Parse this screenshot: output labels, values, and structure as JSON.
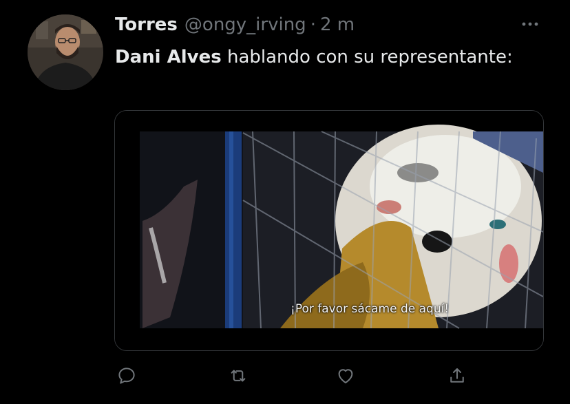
{
  "tweet": {
    "display_name": "Torres",
    "handle": "@ongy_irving",
    "separator": "·",
    "time": "2 m",
    "text_mention": "Dani Alves",
    "text_rest": " hablando con su representante:",
    "media": {
      "subtitle": "¡Por favor sácame de aquí!"
    }
  },
  "actions": [
    "reply-icon",
    "retweet-icon",
    "like-icon",
    "share-icon"
  ],
  "colors": {
    "background": "#000000",
    "text": "#e7e9ea",
    "muted": "#71767b",
    "border": "#333639"
  }
}
